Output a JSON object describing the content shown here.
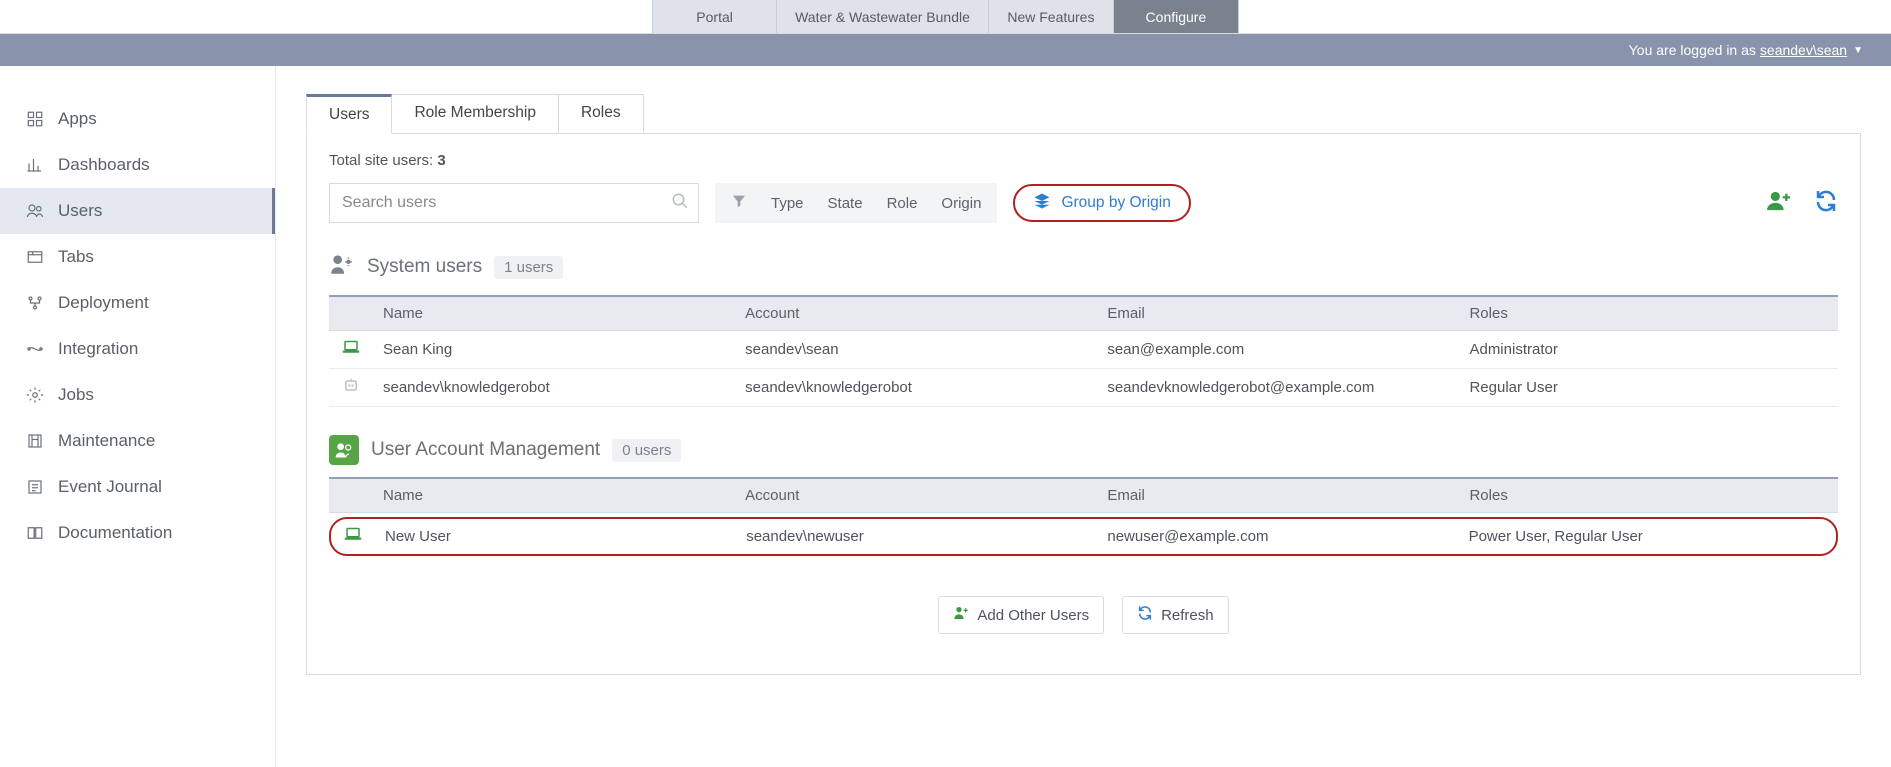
{
  "top_tabs": {
    "portal": "Portal",
    "bundle": "Water & Wastewater Bundle",
    "new_features": "New Features",
    "configure": "Configure"
  },
  "stripe": {
    "prefix": "You are logged in as",
    "username": "seandev\\sean"
  },
  "sidebar": {
    "apps": "Apps",
    "dashboards": "Dashboards",
    "users": "Users",
    "tabs": "Tabs",
    "deployment": "Deployment",
    "integration": "Integration",
    "jobs": "Jobs",
    "maintenance": "Maintenance",
    "event_journal": "Event Journal",
    "documentation": "Documentation"
  },
  "inner_tabs": {
    "users": "Users",
    "role_membership": "Role Membership",
    "roles": "Roles"
  },
  "total_label": "Total site users:",
  "total_count": "3",
  "search_placeholder": "Search users",
  "filters": {
    "type": "Type",
    "state": "State",
    "role": "Role",
    "origin": "Origin"
  },
  "group_by_origin": "Group by Origin",
  "columns": {
    "name": "Name",
    "account": "Account",
    "email": "Email",
    "roles": "Roles"
  },
  "sections": {
    "system": {
      "title": "System users",
      "badge": "1 users",
      "rows": [
        {
          "name": "Sean King",
          "account": "seandev\\sean",
          "email": "sean@example.com",
          "roles": "Administrator",
          "icon": "laptop"
        },
        {
          "name": "seandev\\knowledgerobot",
          "account": "seandev\\knowledgerobot",
          "email": "seandevknowledgerobot@example.com",
          "roles": "Regular User",
          "icon": "robot"
        }
      ]
    },
    "uam": {
      "title": "User Account Management",
      "badge": "0 users",
      "rows": [
        {
          "name": "New User",
          "account": "seandev\\newuser",
          "email": "newuser@example.com",
          "roles": "Power User, Regular User",
          "icon": "laptop"
        }
      ]
    }
  },
  "footer": {
    "add_other": "Add Other Users",
    "refresh": "Refresh"
  }
}
